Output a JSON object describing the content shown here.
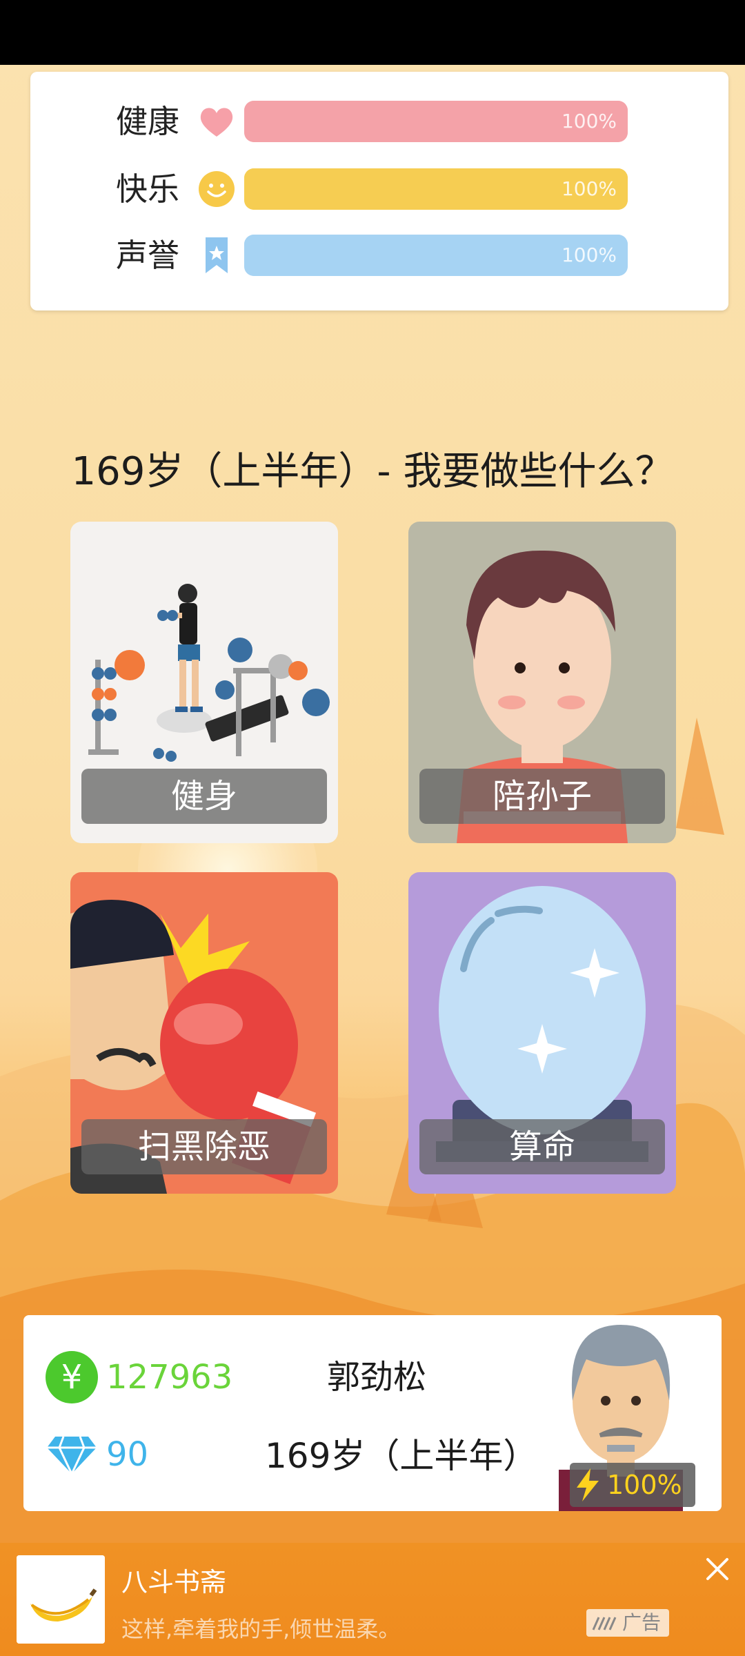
{
  "stats": [
    {
      "label": "健康",
      "icon": "heart-icon",
      "value": "100%",
      "fill": 1.0,
      "color": "#f4a2a8"
    },
    {
      "label": "快乐",
      "icon": "smiley-icon",
      "value": "100%",
      "fill": 1.0,
      "color": "#f6cd52"
    },
    {
      "label": "声誉",
      "icon": "bookmark-star-icon",
      "value": "100%",
      "fill": 1.0,
      "color": "#a6d3f3"
    }
  ],
  "question": "169岁（上半年）- 我要做些什么？",
  "actions": [
    {
      "label": "健身",
      "bg": "#f4f2f0"
    },
    {
      "label": "陪孙子",
      "bg": "#b9b8a6"
    },
    {
      "label": "扫黑除恶",
      "bg": "#f27a55"
    },
    {
      "label": "算命",
      "bg": "#b59bda"
    }
  ],
  "player": {
    "money": "127963",
    "gems": "90",
    "name": "郭劲松",
    "age": "169岁（上半年）",
    "energy": "100%"
  },
  "ad": {
    "title": "八斗书斋",
    "description": "这样,牵着我的手,倾世温柔。",
    "badge": "广告"
  }
}
